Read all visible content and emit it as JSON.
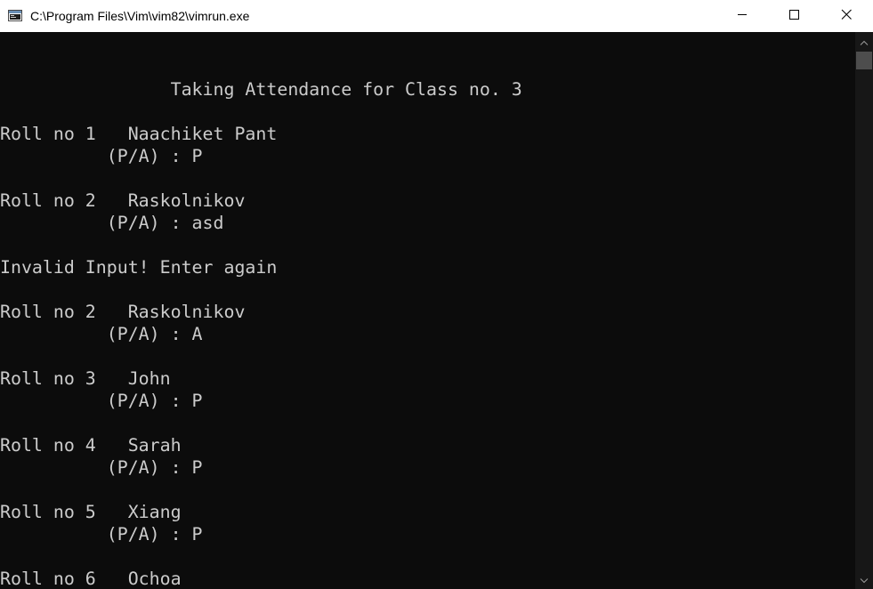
{
  "window": {
    "title": "C:\\Program Files\\Vim\\vim82\\vimrun.exe"
  },
  "console": {
    "lines": [
      {
        "text": "                Taking Attendance for Class no. 3"
      },
      {
        "text": "Roll no 1   Naachiket Pant"
      },
      {
        "text": "          (P/A) : P"
      },
      {
        "text": "Roll no 2   Raskolnikov"
      },
      {
        "text": "          (P/A) : asd"
      },
      {
        "text": "Invalid Input! Enter again"
      },
      {
        "text": "Roll no 2   Raskolnikov"
      },
      {
        "text": "          (P/A) : A"
      },
      {
        "text": "Roll no 3   John"
      },
      {
        "text": "          (P/A) : P"
      },
      {
        "text": "Roll no 4   Sarah"
      },
      {
        "text": "          (P/A) : P"
      },
      {
        "text": "Roll no 5   Xiang"
      },
      {
        "text": "          (P/A) : P"
      },
      {
        "text": "Roll no 6   Ochoa"
      }
    ]
  },
  "icons": {
    "app": "console-window-icon",
    "minimize": "minimize-icon",
    "maximize": "maximize-icon",
    "close": "close-icon",
    "scroll_up": "scroll-up-arrow-icon",
    "scroll_down": "scroll-down-arrow-icon"
  },
  "colors": {
    "console_bg": "#0c0c0c",
    "console_text": "#cccccc",
    "titlebar_bg": "#ffffff"
  }
}
